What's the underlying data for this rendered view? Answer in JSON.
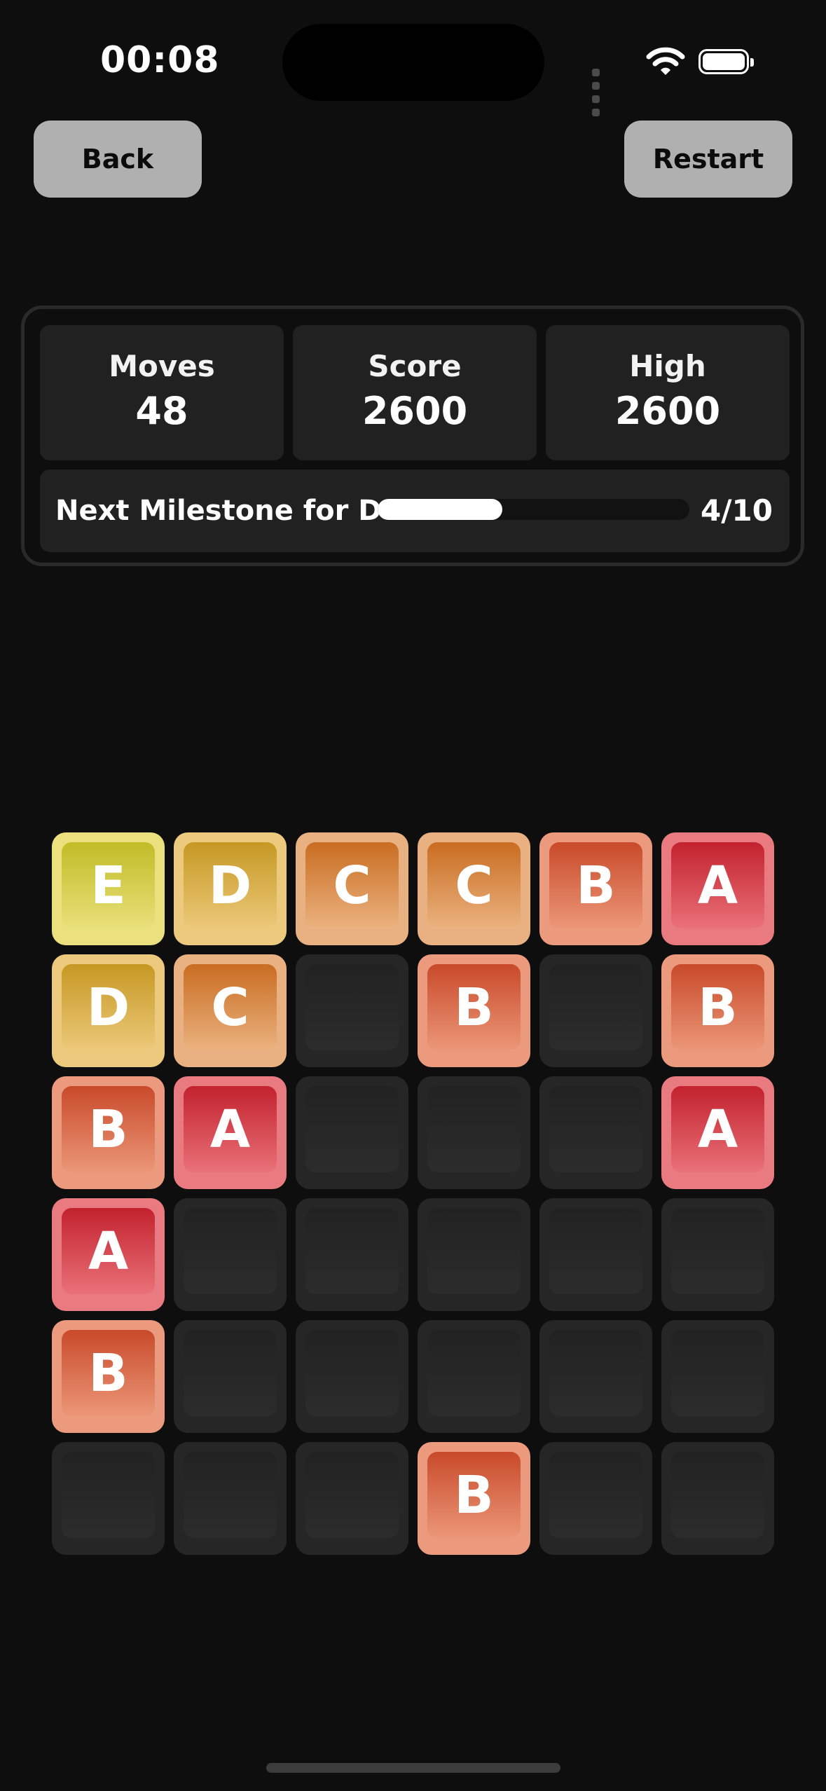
{
  "status_bar": {
    "time": "00:08"
  },
  "buttons": {
    "back": "Back",
    "restart": "Restart"
  },
  "stats": [
    {
      "label": "Moves",
      "value": "48"
    },
    {
      "label": "Score",
      "value": "2600"
    },
    {
      "label": "High",
      "value": "2600"
    }
  ],
  "milestone": {
    "label": "Next Milestone for D",
    "count": "4/10",
    "progress": 0.4
  },
  "board": {
    "rows": [
      [
        "E",
        "D",
        "C",
        "C",
        "B",
        "A"
      ],
      [
        "D",
        "C",
        "",
        "B",
        "",
        "B"
      ],
      [
        "B",
        "A",
        "",
        "",
        "",
        "A"
      ],
      [
        "A",
        "",
        "",
        "",
        "",
        ""
      ],
      [
        "B",
        "",
        "",
        "",
        "",
        ""
      ],
      [
        "",
        "",
        "",
        "B",
        "",
        ""
      ]
    ]
  }
}
